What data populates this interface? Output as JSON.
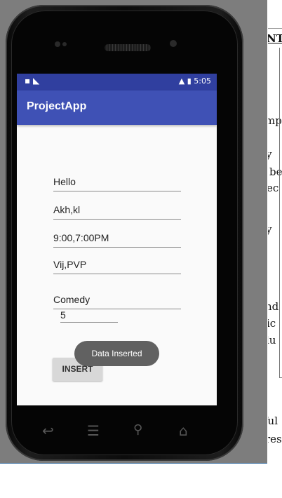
{
  "status_bar": {
    "time": "5:05"
  },
  "app": {
    "title": "ProjectApp"
  },
  "form": {
    "fields": [
      "Hello",
      "Akh,kl",
      "9:00,7:00PM",
      "Vij,PVP",
      "Comedy",
      "5"
    ],
    "insert_button": "INSERT",
    "toast": "Data Inserted"
  },
  "background_document": {
    "fragments": [
      "NT",
      "mp",
      "y",
      "be",
      "ec",
      "y",
      "nd",
      "ic",
      "lu",
      "ful",
      "res"
    ]
  }
}
